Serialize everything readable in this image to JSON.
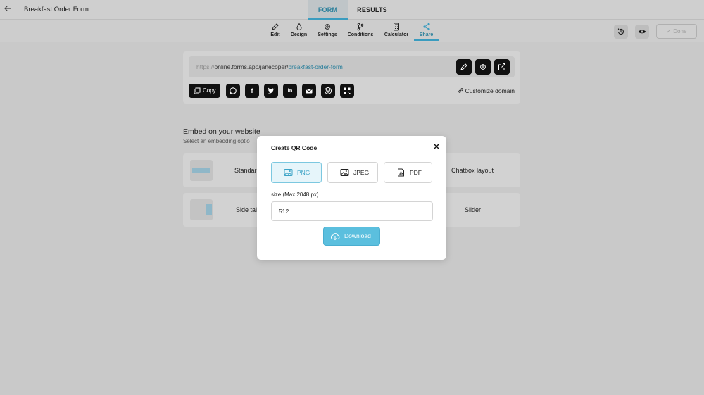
{
  "header": {
    "back_icon": "arrow-left-icon",
    "form_title": "Breakfast Order Form",
    "tabs": [
      {
        "label": "FORM",
        "active": true
      },
      {
        "label": "RESULTS",
        "active": false
      }
    ]
  },
  "toolbar": {
    "items": [
      {
        "label": "Edit",
        "icon": "pencil-icon"
      },
      {
        "label": "Design",
        "icon": "droplet-icon"
      },
      {
        "label": "Settings",
        "icon": "gear-icon"
      },
      {
        "label": "Conditions",
        "icon": "branch-icon"
      },
      {
        "label": "Calculator",
        "icon": "calculator-icon"
      },
      {
        "label": "Share",
        "icon": "share-icon",
        "active": true
      }
    ],
    "done_label": "Done"
  },
  "share": {
    "url_protocol": "https://",
    "url_host": "online.forms.app/janecoper/",
    "url_slug": "breakfast-order-form",
    "copy_label": "Copy",
    "social": [
      "whatsapp-icon",
      "facebook-icon",
      "twitter-icon",
      "linkedin-icon",
      "email-icon",
      "wordpress-icon",
      "qr-code-icon"
    ],
    "customize_domain": "Customize domain"
  },
  "embed": {
    "title": "Embed on your website",
    "subtitle": "Select an embedding optio",
    "options": [
      {
        "label": "Standar"
      },
      {
        "label": "Chatbox layout"
      },
      {
        "label": "Side tal"
      },
      {
        "label": "Slider"
      }
    ]
  },
  "modal": {
    "title": "Create QR Code",
    "formats": [
      {
        "label": "PNG",
        "selected": true
      },
      {
        "label": "JPEG",
        "selected": false
      },
      {
        "label": "PDF",
        "selected": false
      }
    ],
    "size_label": "size (Max 2048 px)",
    "size_value": "512",
    "download_label": "Download"
  },
  "colors": {
    "accent": "#3ba3c6",
    "download_bg": "#5bbfde",
    "overlay": "#c9c9c9"
  }
}
